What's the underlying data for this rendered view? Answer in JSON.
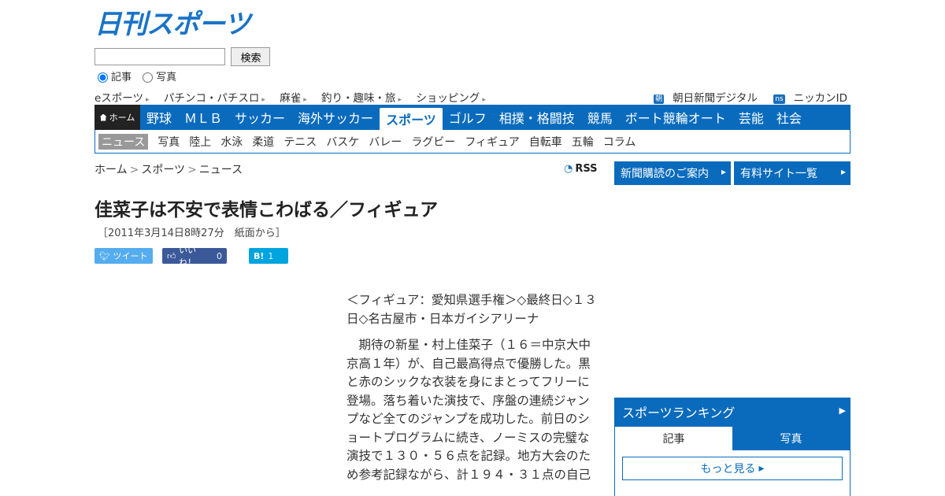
{
  "logo": "日刊スポーツ",
  "search": {
    "button": "検索",
    "radio_article": "記事",
    "radio_photo": "写真"
  },
  "subnav": {
    "items": [
      "eスポーツ",
      "パチンコ・パチスロ",
      "麻雀",
      "釣り・趣味・旅",
      "ショッピング"
    ],
    "asahi_badge": "朝",
    "asahi": "朝日新聞デジタル",
    "nikkan_badge": "ns",
    "nikkan": "ニッカンID"
  },
  "mainnav": {
    "home": "ホーム",
    "items": [
      "野球",
      "ＭＬＢ",
      "サッカー",
      "海外サッカー",
      "スポーツ",
      "ゴルフ",
      "相撲・格闘技",
      "競馬",
      "ボート競輪オート",
      "芸能",
      "社会"
    ],
    "active_index": 4
  },
  "catnav": {
    "items": [
      "ニュース",
      "写真",
      "陸上",
      "水泳",
      "柔道",
      "テニス",
      "バスケ",
      "バレー",
      "ラグビー",
      "フィギュア",
      "自転車",
      "五輪",
      "コラム"
    ],
    "active_index": 0
  },
  "breadcrumb": {
    "home": "ホーム",
    "sep": ">",
    "sports": "スポーツ",
    "news": "ニュース"
  },
  "rss": "RSS",
  "article": {
    "title": "佳菜子は不安で表情こわばる／フィギュア",
    "date": "［2011年3月14日8時27分　紙面から］",
    "para1": "＜フィギュア：愛知県選手権＞◇最終日◇１３日◇名古屋市・日本ガイシアリーナ",
    "para2": "期待の新星・村上佳菜子（１６＝中京大中京高１年）が、自己最高得点で優勝した。黒と赤のシックな衣装を身にまとってフリーに登場。落ち着いた演技で、序盤の連続ジャンプなど全てのジャンプを成功した。前日のショートプログラムに続き、ノーミスの完璧な演技で１３０・５６点を記録。地方大会のため参考記録ながら、計１９４・３１点の自己"
  },
  "social": {
    "tweet": "ツイート",
    "like": "いいね！",
    "like_count": "0",
    "hatena": "B!",
    "hatena_count": "1"
  },
  "sidebar": {
    "btn1": "新聞購読のご案内",
    "btn2": "有料サイト一覧",
    "ranking_title": "スポーツランキング",
    "tab_article": "記事",
    "tab_photo": "写真",
    "more": "もっと見る"
  }
}
